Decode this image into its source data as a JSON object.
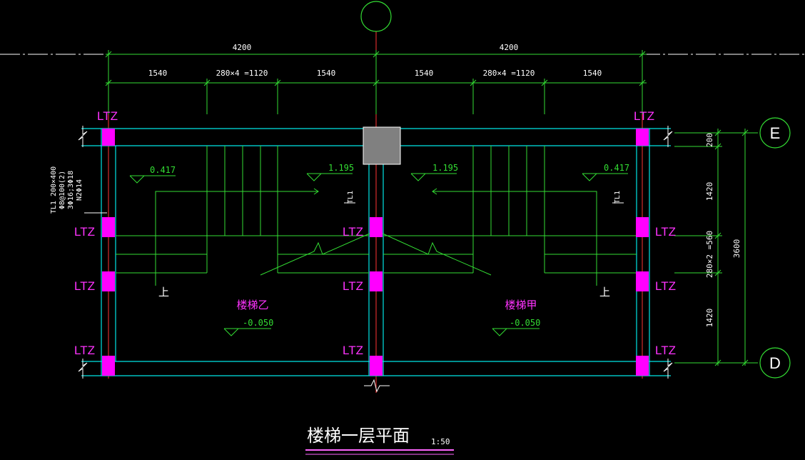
{
  "dimensions": {
    "top_total": [
      "4200",
      "4200"
    ],
    "top_parts": [
      "1540",
      "280×4 =1120",
      "1540",
      "1540",
      "280×4 =1120",
      "1540"
    ],
    "right": [
      "200",
      "1420",
      "280×2 =560",
      "1420"
    ],
    "right_total": "3600"
  },
  "axes": {
    "top": "",
    "right_upper": "E",
    "right_lower": "D"
  },
  "levels": {
    "left_landing": "0.417",
    "mid_left": "1.195",
    "mid_right": "1.195",
    "right_landing": "0.417",
    "floor_left": "-0.050",
    "floor_right": "-0.050"
  },
  "column_label": "LTZ",
  "beam_tag": "TL1",
  "beam_note": [
    "TL1 200×400",
    "Φ8@100(2)",
    "3Φ16;3Φ18",
    "N2Φ14"
  ],
  "up_label": "上",
  "stairs": {
    "left_name": "楼梯乙",
    "right_name": "楼梯甲"
  },
  "title": {
    "text": "楼梯一层平面",
    "scale": "1:50"
  },
  "colors": {
    "background": "#000000",
    "dimension": "#33dd33",
    "wall": "#00e5e5",
    "column": "#ff00ff",
    "axis": "#ff3333",
    "text": "#ffffff"
  }
}
